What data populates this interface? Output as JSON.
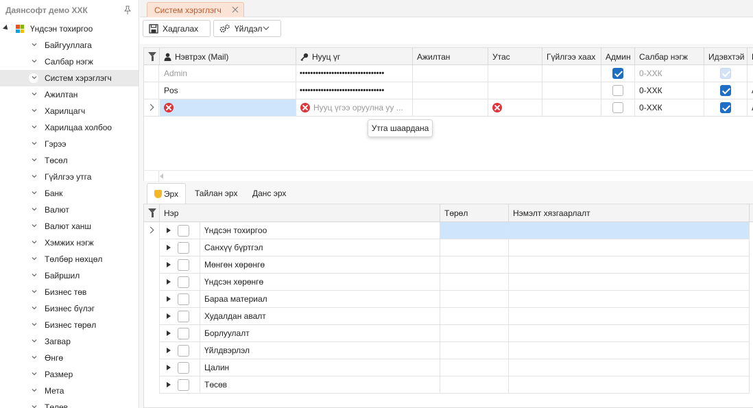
{
  "sidebar": {
    "title": "Даянсофт демо ХХК",
    "root_label": "Үндсэн тохиргоо",
    "items": [
      {
        "label": "Байгууллага"
      },
      {
        "label": "Салбар нэгж"
      },
      {
        "label": "Систем хэрэглэгч",
        "selected": true
      },
      {
        "label": "Ажилтан"
      },
      {
        "label": "Харилцагч"
      },
      {
        "label": "Харилцаа холбоо"
      },
      {
        "label": "Гэрээ"
      },
      {
        "label": "Төсөл"
      },
      {
        "label": "Гүйлгээ утга"
      },
      {
        "label": "Банк"
      },
      {
        "label": "Валют"
      },
      {
        "label": "Валют ханш"
      },
      {
        "label": "Хэмжих нэгж"
      },
      {
        "label": "Төлбөр нөхцөл"
      },
      {
        "label": "Байршил"
      },
      {
        "label": "Бизнес төв"
      },
      {
        "label": "Бизнес бүлэг"
      },
      {
        "label": "Бизнес төрөл"
      },
      {
        "label": "Загвар"
      },
      {
        "label": "Өнгө"
      },
      {
        "label": "Размер"
      },
      {
        "label": "Мета"
      },
      {
        "label": "Төлөв"
      }
    ]
  },
  "doc_tab": {
    "label": "Систем хэрэглэгч"
  },
  "toolbar": {
    "save_label": "Хадгалах",
    "actions_label": "Үйлдэл"
  },
  "users_grid": {
    "columns": [
      "Нэвтрэх (Mail)",
      "Нууц үг",
      "Ажилтан",
      "Утас",
      "Гүйлгээ хаах",
      "Админ",
      "Салбар нэгж",
      "Идэвхтэй",
      "Н"
    ],
    "rows": [
      {
        "login": "Admin",
        "password": "••••••••••••••••••••••••••••••••",
        "employee": "",
        "phone": "",
        "tx_close": "",
        "admin": true,
        "branch": "0-ХХК",
        "active": true,
        "extra": ""
      },
      {
        "login": "Pos",
        "password": "••••••••••••••••••••••••••••••••",
        "employee": "",
        "phone": "",
        "tx_close": "",
        "admin": false,
        "branch": "0-ХХК",
        "active": true,
        "extra": "A"
      },
      {
        "login": "",
        "password_placeholder": "Нууц үгээ оруулна уу ...",
        "employee": "",
        "phone": "",
        "tx_close": "",
        "admin": false,
        "branch": "0-ХХК",
        "active": true,
        "extra": "A"
      }
    ],
    "tooltip": "Утга шаардана"
  },
  "sub_tabs": [
    "Эрх",
    "Тайлан эрх",
    "Данс эрх"
  ],
  "perm_grid": {
    "columns": [
      "Нэр",
      "Төрөл",
      "Нэмэлт хязгаарлалт"
    ],
    "rows": [
      {
        "name": "Үндсэн тохиргоо"
      },
      {
        "name": "Санхүү бүртгэл"
      },
      {
        "name": "Мөнгөн хөрөнгө"
      },
      {
        "name": "Үндсэн хөрөнгө"
      },
      {
        "name": "Бараа материал"
      },
      {
        "name": "Худалдан авалт"
      },
      {
        "name": "Борлуулалт"
      },
      {
        "name": "Үйлдвэрлэл"
      },
      {
        "name": "Цалин"
      },
      {
        "name": "Төсөв"
      }
    ]
  },
  "colors": {
    "accent": "#1e6fc4",
    "tab_accent": "#c05a2a",
    "selection": "#cfe5fb",
    "error": "#e0343a"
  }
}
